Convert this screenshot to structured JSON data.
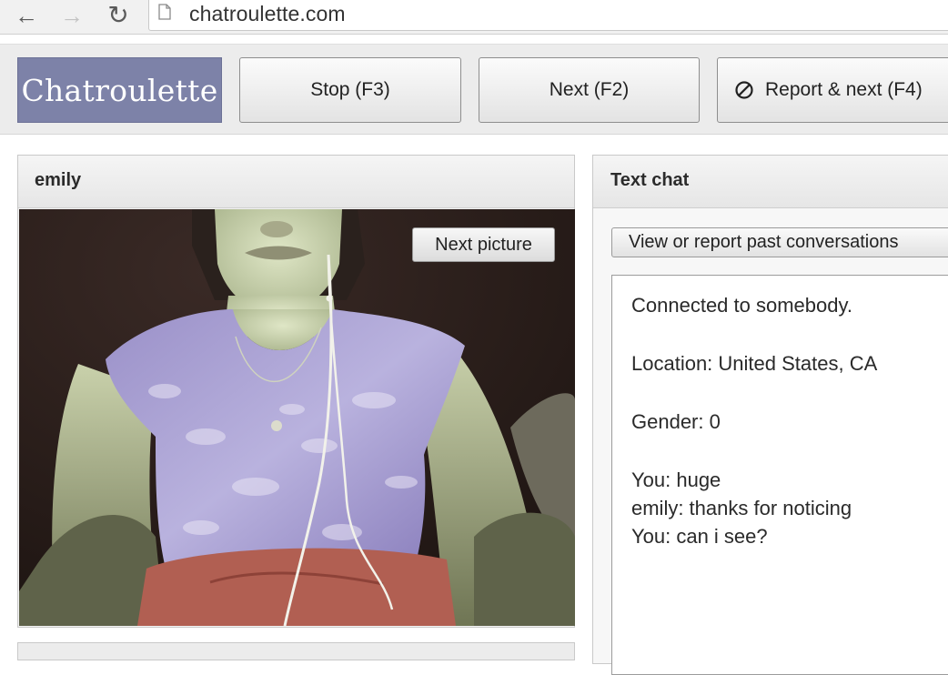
{
  "browser": {
    "url": "chatroulette.com",
    "icons": {
      "back": "back-arrow-icon",
      "forward": "forward-arrow-icon",
      "reload": "reload-icon",
      "page": "page-icon"
    }
  },
  "toolbar": {
    "logo": "Chatroulette",
    "stop_label": "Stop (F3)",
    "next_label": "Next (F2)",
    "report_label": "Report & next (F4)",
    "report_icon": "prohibited-icon"
  },
  "video_panel": {
    "partner_name": "emily",
    "next_picture_label": "Next picture"
  },
  "chat_panel": {
    "title": "Text chat",
    "past_conversations_label": "View or report past conversations",
    "status": "Connected to somebody.",
    "location": "Location: United States, CA",
    "gender": "Gender: 0",
    "messages": [
      "You: huge",
      "emily: thanks for noticing",
      "You: can i see?"
    ]
  },
  "colors": {
    "logo_bg": "#7d82a8",
    "toolbar_bg": "#ececec",
    "panel_header_bg": "#e6e6e6"
  }
}
